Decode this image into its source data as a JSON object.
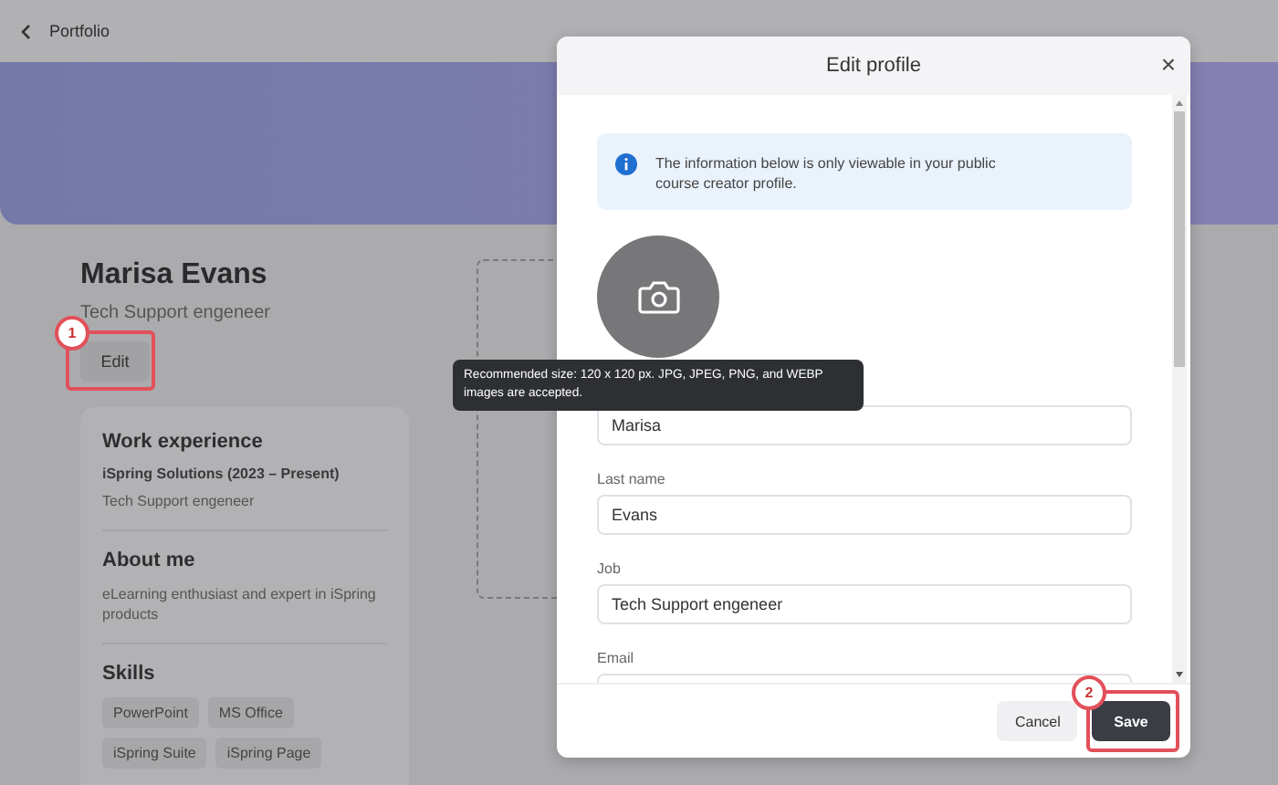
{
  "top_bar": {
    "back_label": "Portfolio"
  },
  "profile": {
    "name": "Marisa Evans",
    "job": "Tech Support engeneer",
    "edit_button": "Edit"
  },
  "sections": [
    {
      "kind": "experience",
      "title": "Work experience",
      "company": "iSpring Solutions (2023 – Present)",
      "role": "Tech Support engeneer"
    },
    {
      "kind": "text",
      "title": "About me",
      "text": "eLearning enthusiast and expert in iSpring products"
    },
    {
      "kind": "tags",
      "title": "Skills",
      "tags": [
        "PowerPoint",
        "MS Office",
        "iSpring Suite",
        "iSpring Page"
      ]
    }
  ],
  "dialog": {
    "title": "Edit profile",
    "close": "×",
    "notice": "The information below is only viewable in your public course creator profile.",
    "fields": [
      {
        "value": "Marisa"
      },
      {
        "label": "Last name",
        "value": "Evans"
      },
      {
        "label": "Job",
        "value": "Tech Support engeneer"
      },
      {
        "label": "Email"
      }
    ],
    "buttons": [
      {
        "label": "Cancel",
        "kind": "secondary"
      },
      {
        "label": "Save",
        "kind": "primary"
      }
    ]
  },
  "tooltip": "Recommended size: 120 x 120 px. JPG, JPEG, PNG, and WEBP images are accepted.",
  "callouts": [
    "1",
    "2"
  ]
}
